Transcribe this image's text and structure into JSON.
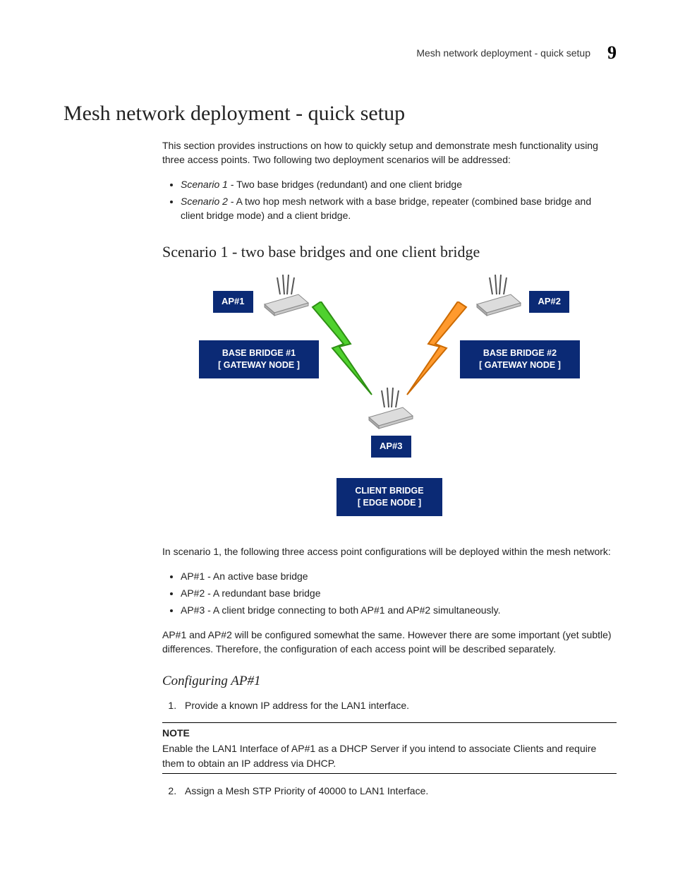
{
  "running_header": {
    "text": "Mesh network deployment - quick setup",
    "number": "9"
  },
  "title": "Mesh network deployment - quick setup",
  "intro": "This section provides instructions on how to quickly setup and demonstrate mesh functionality using three access points. Two following two deployment scenarios will be addressed:",
  "scenarios": {
    "item1_label": "Scenario 1",
    "item1_desc": " - Two base bridges (redundant) and one client bridge",
    "item2_label": "Scenario 2",
    "item2_desc": " - A two hop mesh network with a base bridge, repeater (combined base bridge and client bridge mode) and a client bridge."
  },
  "scenario1": {
    "heading": "Scenario 1 - two base bridges and one client bridge",
    "diagram": {
      "ap1": "AP#1",
      "ap2": "AP#2",
      "ap3": "AP#3",
      "bb1_l1": "BASE BRIDGE #1",
      "bb1_l2": "[ GATEWAY NODE ]",
      "bb2_l1": "BASE BRIDGE #2",
      "bb2_l2": "[ GATEWAY NODE ]",
      "cb_l1": "CLIENT BRIDGE",
      "cb_l2": "[ EDGE NODE ]"
    },
    "description": "In scenario 1, the following three access point configurations will be deployed within the mesh network:",
    "bullets": [
      "AP#1 - An active base bridge",
      "AP#2 - A redundant base bridge",
      "AP#3 - A client bridge connecting to both AP#1 and AP#2 simultaneously."
    ],
    "post_bullets": "AP#1 and AP#2 will be configured somewhat the same. However there are some important (yet subtle) differences. Therefore, the configuration of each access point will be described separately.",
    "config_ap1": {
      "heading": "Configuring AP#1",
      "step1": "Provide a known IP address for the LAN1 interface.",
      "note_label": "NOTE",
      "note_text": "Enable the LAN1 Interface of AP#1 as a DHCP Server if you intend to associate Clients and require them to obtain an IP address via DHCP.",
      "step2": "Assign a Mesh STP Priority of 40000 to LAN1 Interface."
    }
  }
}
